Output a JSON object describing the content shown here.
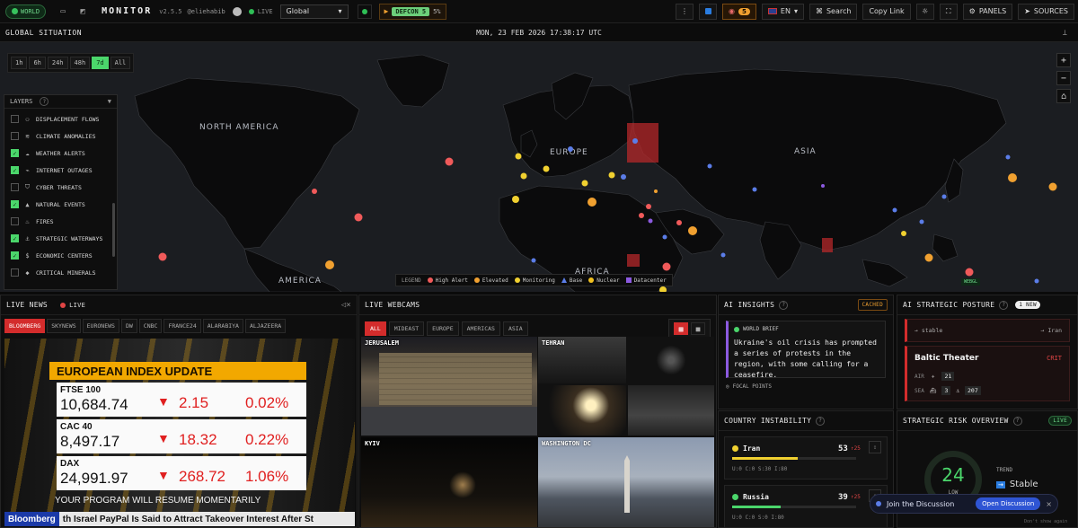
{
  "topbar": {
    "world_label": "WORLD",
    "brand": "MONITOR",
    "version": "v2.5.5",
    "handle": "@eliehabib",
    "live_label": "LIVE",
    "region": "Global",
    "defcon_label": "DEFCON 5",
    "defcon_pct": "5%",
    "alert_count": "5",
    "lang": "EN",
    "search_label": "Search",
    "copy_link_label": "Copy Link",
    "panels_label": "PANELS",
    "sources_label": "SOURCES"
  },
  "map": {
    "title": "GLOBAL SITUATION",
    "clock": "MON, 23 FEB 2026 17:38:17 UTC",
    "time_ranges": [
      "1h",
      "6h",
      "24h",
      "48h",
      "7d",
      "All"
    ],
    "active_time_range": "7d",
    "region_labels": [
      "NORTH AMERICA",
      "EUROPE",
      "ASIA",
      "AFRICA",
      "AMERICA"
    ],
    "webgl_label": "WEBGL",
    "layers": {
      "title": "LAYERS",
      "items": [
        {
          "label": "DISPLACEMENT FLOWS",
          "checked": false,
          "icon": "people-icon"
        },
        {
          "label": "CLIMATE ANOMALIES",
          "checked": false,
          "icon": "thermometer-icon"
        },
        {
          "label": "WEATHER ALERTS",
          "checked": true,
          "icon": "cloud-icon"
        },
        {
          "label": "INTERNET OUTAGES",
          "checked": true,
          "icon": "signal-icon"
        },
        {
          "label": "CYBER THREATS",
          "checked": false,
          "icon": "shield-icon"
        },
        {
          "label": "NATURAL EVENTS",
          "checked": true,
          "icon": "volcano-icon"
        },
        {
          "label": "FIRES",
          "checked": false,
          "icon": "fire-icon"
        },
        {
          "label": "STRATEGIC WATERWAYS",
          "checked": true,
          "icon": "anchor-icon"
        },
        {
          "label": "ECONOMIC CENTERS",
          "checked": true,
          "icon": "money-icon"
        },
        {
          "label": "CRITICAL MINERALS",
          "checked": false,
          "icon": "gem-icon"
        }
      ]
    },
    "legend": {
      "title": "LEGEND",
      "items": [
        {
          "label": "High Alert",
          "color": "#f05a5a",
          "shape": "circle"
        },
        {
          "label": "Elevated",
          "color": "#f0a030",
          "shape": "circle"
        },
        {
          "label": "Monitoring",
          "color": "#f0d030",
          "shape": "circle"
        },
        {
          "label": "Base",
          "color": "#5b7de8",
          "shape": "triangle"
        },
        {
          "label": "Nuclear",
          "color": "#f0c020",
          "shape": "circle"
        },
        {
          "label": "Datacenter",
          "color": "#8c5ae0",
          "shape": "square"
        }
      ]
    }
  },
  "news": {
    "title": "LIVE NEWS",
    "live_label": "LIVE",
    "channels": [
      "BLOOMBERG",
      "SKYNEWS",
      "EURONEWS",
      "DW",
      "CNBC",
      "FRANCE24",
      "ALARABIYA",
      "ALJAZEERA"
    ],
    "active_channel": "BLOOMBERG",
    "broadcast": {
      "header": "EUROPEAN INDEX UPDATE",
      "rows": [
        {
          "name": "FTSE 100",
          "value": "10,684.74",
          "change": "2.15",
          "pct": "0.02%"
        },
        {
          "name": "CAC 40",
          "value": "8,497.17",
          "change": "18.32",
          "pct": "0.22%"
        },
        {
          "name": "DAX",
          "value": "24,991.97",
          "change": "268.72",
          "pct": "1.06%"
        }
      ],
      "resume": "YOUR PROGRAM WILL RESUME MOMENTARILY",
      "ticker_brand": "Bloomberg",
      "ticker_text": "th Israel    PayPal Is Said to Attract Takeover Interest After St"
    }
  },
  "webcams": {
    "title": "LIVE WEBCAMS",
    "tabs": [
      "ALL",
      "MIDEAST",
      "EUROPE",
      "AMERICAS",
      "ASIA"
    ],
    "active_tab": "ALL",
    "cams": [
      "JERUSALEM",
      "TEHRAN",
      "KYIV",
      "WASHINGTON DC"
    ]
  },
  "insights": {
    "title": "AI INSIGHTS",
    "cached_label": "CACHED",
    "brief_label": "WORLD BRIEF",
    "brief_text": "Ukraine's oil crisis has prompted a series of protests in the region, with some calling for a ceasefire.",
    "focal_label": "FOCAL POINTS"
  },
  "instability": {
    "title": "COUNTRY INSTABILITY",
    "rows": [
      {
        "country": "Iran",
        "score": "53",
        "trend": "↑25",
        "stats": "U:0  C:0  S:30  I:80",
        "color": "#f0d030",
        "fill": 0.53
      },
      {
        "country": "Russia",
        "score": "39",
        "trend": "↑25",
        "stats": "U:0  C:0  S:0  I:80",
        "color": "#4bd66b",
        "fill": 0.39
      }
    ]
  },
  "posture": {
    "title": "AI STRATEGIC POSTURE",
    "new_label": "1 NEW",
    "prev_left": "→ stable",
    "prev_right": "→ Iran",
    "theater": "Baltic Theater",
    "level": "CRIT",
    "air_label": "AIR",
    "air_value": "21",
    "sea_label": "SEA",
    "sea_value_a": "3",
    "sea_value_b": "207"
  },
  "risk": {
    "title": "STRATEGIC RISK OVERVIEW",
    "live_label": "LIVE",
    "score": "24",
    "level": "LOW",
    "trend_label": "TREND",
    "trend_value": "Stable"
  },
  "discussion": {
    "label": "Join the Discussion",
    "button": "Open Discussion",
    "dont_show": "Don't show again"
  }
}
